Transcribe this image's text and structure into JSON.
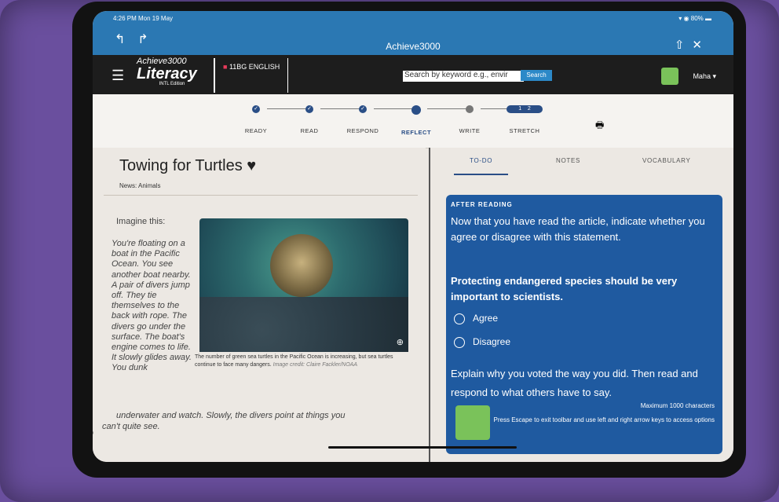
{
  "status_bar": {
    "time": "4:26 PM  Mon 19 May",
    "battery": "80%"
  },
  "browser": {
    "title": "Achieve3000"
  },
  "app": {
    "logo_top": "Achieve3000",
    "logo_main": "Literacy",
    "logo_sub": "INTL Edition",
    "course": "11BG ENGLISH",
    "search_placeholder": "Search by keyword e.g., envir",
    "search_button": "Search",
    "user": "Maha"
  },
  "steps": [
    {
      "label": "READY",
      "state": "done"
    },
    {
      "label": "READ",
      "state": "done"
    },
    {
      "label": "RESPOND",
      "state": "done"
    },
    {
      "label": "REFLECT",
      "state": "current"
    },
    {
      "label": "WRITE",
      "state": "todo"
    },
    {
      "label": "STRETCH",
      "state": "todo",
      "badges": [
        "1",
        "2"
      ]
    }
  ],
  "article": {
    "title": "Towing for Turtles",
    "category": "News: Animals",
    "intro": "Imagine this:",
    "paragraph_left": "You're floating on a boat in the Pacific Ocean. You see another boat nearby. A pair of divers jump off. They tie themselves to the back with rope. The divers go under the surface. The boat's engine comes to life. It slowly glides away. You dunk",
    "paragraph_wide_1": "underwater and watch. Slowly, the divers point at things you",
    "paragraph_wide_2": "can't quite see.",
    "caption": "The number of green sea turtles in the Pacific Ocean is increasing, but sea turtles continue to face many dangers.",
    "credit": "Image credit: Claire Fackler/NOAA"
  },
  "tabs": [
    "TO-DO",
    "NOTES",
    "VOCABULARY"
  ],
  "panel": {
    "heading": "AFTER READING",
    "instruction": "Now that you have read the article, indicate whether you agree or disagree with this statement.",
    "statement": "Protecting endangered species should be very important to scientists.",
    "options": [
      "Agree",
      "Disagree"
    ],
    "explain": "Explain why you voted the way you did. Then read and respond to what others have to say.",
    "max_chars": "Maximum 1000 characters",
    "toolbar_hint": "Press Escape to exit toolbar and use left and right arrow keys to access options"
  }
}
